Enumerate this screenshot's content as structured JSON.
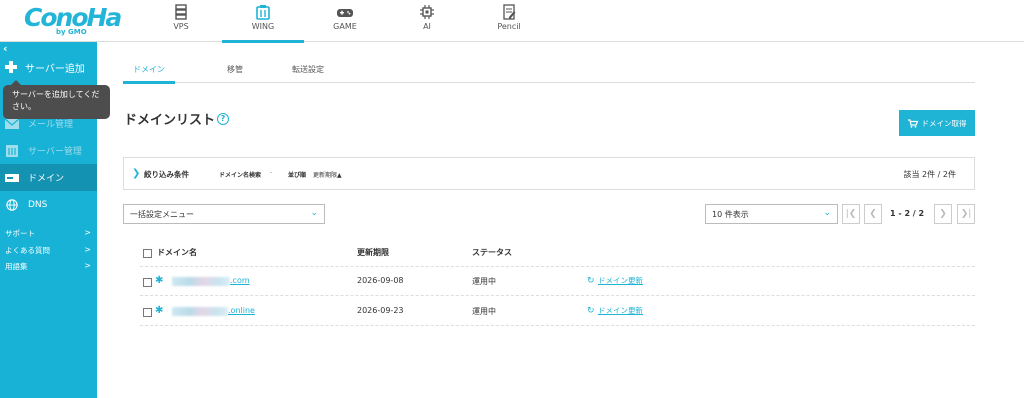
{
  "app": {
    "logo_text": "ConoHa",
    "logo_sub": "by GMO"
  },
  "topnav": [
    {
      "label": "VPS",
      "icon": "server-icon"
    },
    {
      "label": "WING",
      "icon": "wing-icon",
      "active": true
    },
    {
      "label": "GAME",
      "icon": "gamepad-icon"
    },
    {
      "label": "AI",
      "icon": "ai-icon"
    },
    {
      "label": "Pencil",
      "icon": "pencil-icon"
    }
  ],
  "sidebar": {
    "collapse": "‹",
    "add_server": "サーバー追加",
    "tooltip": "サーバーを追加してください。",
    "items": [
      {
        "label": "メール管理",
        "icon": "mail-icon",
        "state": "dim"
      },
      {
        "label": "サーバー管理",
        "icon": "server-icon",
        "state": "dim"
      },
      {
        "label": "ドメイン",
        "icon": "domain-icon",
        "state": "active"
      },
      {
        "label": "DNS",
        "icon": "globe-icon",
        "state": "normal"
      }
    ],
    "links": [
      {
        "label": "サポート",
        "arrow": ">"
      },
      {
        "label": "よくある質問",
        "arrow": ">"
      },
      {
        "label": "用語集",
        "arrow": ">"
      }
    ]
  },
  "tabs": [
    "ドメイン",
    "移管",
    "転送設定"
  ],
  "page": {
    "title": "ドメインリスト",
    "help": "?",
    "get_domain_button": "ドメイン取得"
  },
  "filter": {
    "toggle": "❯",
    "title": "絞り込み条件",
    "search_label": "ドメイン名検索",
    "search_value": "-",
    "sort_label": "並び順",
    "sort_value": "更新期限▲",
    "count": "該当 2件 / 2件"
  },
  "controls": {
    "bulk_menu": "一括設定メニュー",
    "per_page": "10 件表示",
    "page_info": "1 - 2 / 2",
    "first": "|❮",
    "prev": "❮",
    "next": "❯",
    "last": "❯|"
  },
  "table": {
    "headers": {
      "name": "ドメイン名",
      "expiry": "更新期限",
      "status": "ステータス"
    },
    "rows": [
      {
        "suffix": ".com",
        "expiry": "2026-09-08",
        "status": "運用中",
        "action": "ドメイン更新"
      },
      {
        "suffix": ".online",
        "expiry": "2026-09-23",
        "status": "運用中",
        "action": "ドメイン更新"
      }
    ]
  },
  "colors": {
    "accent": "#1fb3d6",
    "sidebar": "#17b2d6",
    "sidebar_active": "#1492b2"
  }
}
